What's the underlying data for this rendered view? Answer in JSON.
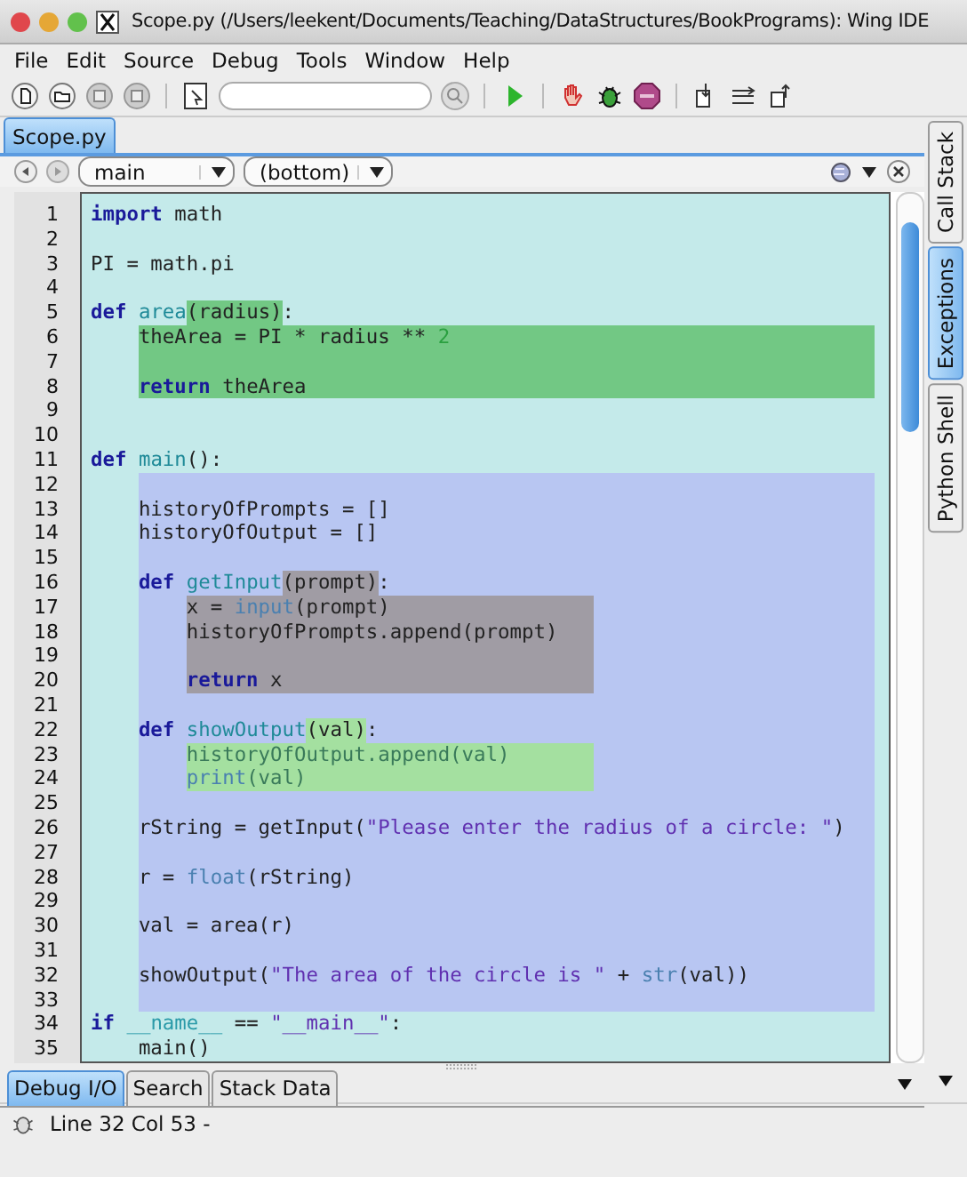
{
  "window": {
    "title": "Scope.py (/Users/leekent/Documents/Teaching/DataStructures/BookPrograms): Wing IDE"
  },
  "menu": [
    "File",
    "Edit",
    "Source",
    "Debug",
    "Tools",
    "Window",
    "Help"
  ],
  "editor_tabs": [
    {
      "label": "Scope.py",
      "selected": true
    }
  ],
  "navigator": {
    "scope": "main",
    "position": "(bottom)"
  },
  "code": {
    "items": [
      {
        "kind": "line",
        "number": "1",
        "tokens": [
          {
            "text": "import",
            "kind": "keyword"
          },
          {
            "text": " math",
            "kind": "plain"
          }
        ]
      },
      {
        "kind": "line",
        "number": "2"
      },
      {
        "kind": "line",
        "number": "3",
        "tokens": [
          {
            "text": "PI = math.pi",
            "kind": "plain"
          }
        ]
      },
      {
        "kind": "line",
        "number": "4"
      },
      {
        "kind": "line",
        "number": "5",
        "tokens": [
          {
            "text": "def",
            "kind": "keyword"
          },
          {
            "text": " area",
            "kind": "defname"
          },
          {
            "text": "(radius)",
            "kind": "plain",
            "color": "#72c884"
          },
          {
            "text": ":",
            "kind": "plain"
          }
        ]
      },
      {
        "kind": "block",
        "color": "#72c884",
        "children": [
          {
            "kind": "line",
            "number": "6",
            "tokens": [
              {
                "text": "theArea = PI * radius ** ",
                "kind": "plain"
              },
              {
                "text": "2",
                "kind": "number"
              }
            ]
          },
          {
            "kind": "line",
            "number": "7"
          },
          {
            "kind": "line",
            "number": "8",
            "tokens": [
              {
                "text": "return",
                "kind": "keyword"
              },
              {
                "text": " theArea",
                "kind": "plain"
              }
            ]
          }
        ]
      },
      {
        "kind": "line",
        "number": "9"
      },
      {
        "kind": "line",
        "number": "10"
      },
      {
        "kind": "line",
        "number": "11",
        "tokens": [
          {
            "text": "def",
            "kind": "keyword"
          },
          {
            "text": " main",
            "kind": "defname"
          },
          {
            "text": "():",
            "kind": "plain"
          }
        ]
      },
      {
        "kind": "block",
        "color": "#b8c6f2",
        "children": [
          {
            "kind": "line",
            "number": "12"
          },
          {
            "kind": "line",
            "number": "13",
            "tokens": [
              {
                "text": "historyOfPrompts = []",
                "kind": "plain"
              }
            ]
          },
          {
            "kind": "line",
            "number": "14",
            "tokens": [
              {
                "text": "historyOfOutput = []",
                "kind": "plain"
              }
            ]
          },
          {
            "kind": "line",
            "number": "15"
          },
          {
            "kind": "line",
            "number": "16",
            "tokens": [
              {
                "text": "def",
                "kind": "keyword"
              },
              {
                "text": " getInput",
                "kind": "defname"
              },
              {
                "text": "(prompt)",
                "kind": "plain",
                "color": "#a09ca4"
              },
              {
                "text": ":",
                "kind": "plain"
              }
            ]
          },
          {
            "kind": "block",
            "color": "#a09ca4",
            "children": [
              {
                "kind": "line",
                "number": "17",
                "tokens": [
                  {
                    "text": "x = ",
                    "kind": "plain"
                  },
                  {
                    "text": "input",
                    "kind": "builtin"
                  },
                  {
                    "text": "(prompt)",
                    "kind": "plain"
                  }
                ]
              },
              {
                "kind": "line",
                "number": "18",
                "tokens": [
                  {
                    "text": "historyOfPrompts.append(prompt)",
                    "kind": "plain"
                  }
                ]
              },
              {
                "kind": "line",
                "number": "19"
              },
              {
                "kind": "line",
                "number": "20",
                "tokens": [
                  {
                    "text": "return",
                    "kind": "keyword"
                  },
                  {
                    "text": " x",
                    "kind": "plain"
                  }
                ]
              }
            ]
          },
          {
            "kind": "line",
            "number": "21"
          },
          {
            "kind": "line",
            "number": "22",
            "tokens": [
              {
                "text": "def",
                "kind": "keyword"
              },
              {
                "text": " showOutput",
                "kind": "defname"
              },
              {
                "text": "(val)",
                "kind": "plain",
                "color": "#a4e0a0"
              },
              {
                "text": ":",
                "kind": "plain"
              }
            ]
          },
          {
            "kind": "block",
            "color": "#a4e0a0",
            "children": [
              {
                "kind": "line",
                "number": "23",
                "tokens": [
                  {
                    "text": "historyOfOutput.append(val)",
                    "kind": "dim"
                  }
                ]
              },
              {
                "kind": "line",
                "number": "24",
                "tokens": [
                  {
                    "text": "print",
                    "kind": "builtin"
                  },
                  {
                    "text": "(val)",
                    "kind": "dim"
                  }
                ]
              }
            ]
          },
          {
            "kind": "line",
            "number": "25"
          },
          {
            "kind": "line",
            "number": "26",
            "tokens": [
              {
                "text": "rString = getInput(",
                "kind": "plain"
              },
              {
                "text": "\"Please enter the radius of a circle: \"",
                "kind": "string"
              },
              {
                "text": ")",
                "kind": "plain"
              }
            ]
          },
          {
            "kind": "line",
            "number": "27"
          },
          {
            "kind": "line",
            "number": "28",
            "tokens": [
              {
                "text": "r = ",
                "kind": "plain"
              },
              {
                "text": "float",
                "kind": "builtin"
              },
              {
                "text": "(rString)",
                "kind": "plain"
              }
            ]
          },
          {
            "kind": "line",
            "number": "29"
          },
          {
            "kind": "line",
            "number": "30",
            "tokens": [
              {
                "text": "val = area(r)",
                "kind": "plain"
              }
            ]
          },
          {
            "kind": "line",
            "number": "31"
          },
          {
            "kind": "line",
            "number": "32",
            "tokens": [
              {
                "text": "showOutput(",
                "kind": "plain"
              },
              {
                "text": "\"The area of the circle is \"",
                "kind": "string"
              },
              {
                "text": " + ",
                "kind": "plain"
              },
              {
                "text": "str",
                "kind": "builtin"
              },
              {
                "text": "(val))",
                "kind": "plain"
              }
            ]
          },
          {
            "kind": "line",
            "number": "33"
          }
        ]
      },
      {
        "kind": "line",
        "number": "34",
        "tokens": [
          {
            "text": "if",
            "kind": "keyword"
          },
          {
            "text": " __name__",
            "kind": "dunder"
          },
          {
            "text": " == ",
            "kind": "plain"
          },
          {
            "text": "\"__main__\"",
            "kind": "string"
          },
          {
            "text": ":",
            "kind": "plain"
          }
        ]
      },
      {
        "kind": "line",
        "number": "35",
        "tokens": [
          {
            "text": "    main()",
            "kind": "plain"
          }
        ]
      }
    ]
  },
  "side_tabs": [
    {
      "label": "Call Stack",
      "selected": false
    },
    {
      "label": "Exceptions",
      "selected": true
    },
    {
      "label": "Python Shell",
      "selected": false
    }
  ],
  "bottom_tabs": [
    {
      "label": "Debug I/O",
      "selected": true
    },
    {
      "label": "Search",
      "selected": false
    },
    {
      "label": "Stack Data",
      "selected": false
    }
  ],
  "status_bar": {
    "text": "Line 32 Col 53 -"
  }
}
